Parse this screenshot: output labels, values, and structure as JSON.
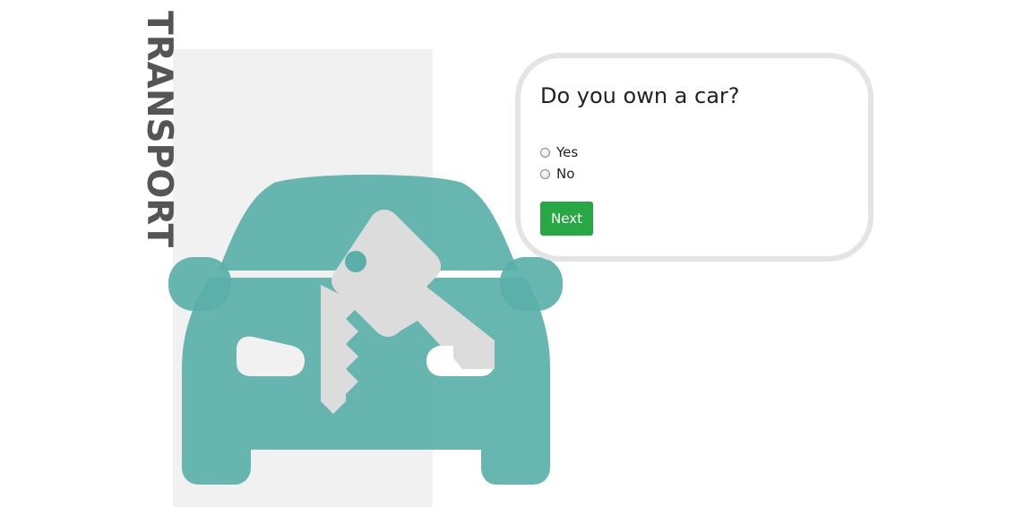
{
  "section": {
    "title": "TRANSPORT"
  },
  "question": {
    "title": "Do you own a car?",
    "options": [
      {
        "label": "Yes",
        "selected": false
      },
      {
        "label": "No",
        "selected": false
      }
    ],
    "next_label": "Next"
  },
  "illustration": {
    "icon": "car-with-key-icon",
    "car_color": "#5ab0a8",
    "key_color": "#dcdcdc"
  },
  "colors": {
    "panel": "#f1f1f1",
    "title_text": "#555555",
    "card_border": "#e4e4e4",
    "button": "#28a745"
  }
}
